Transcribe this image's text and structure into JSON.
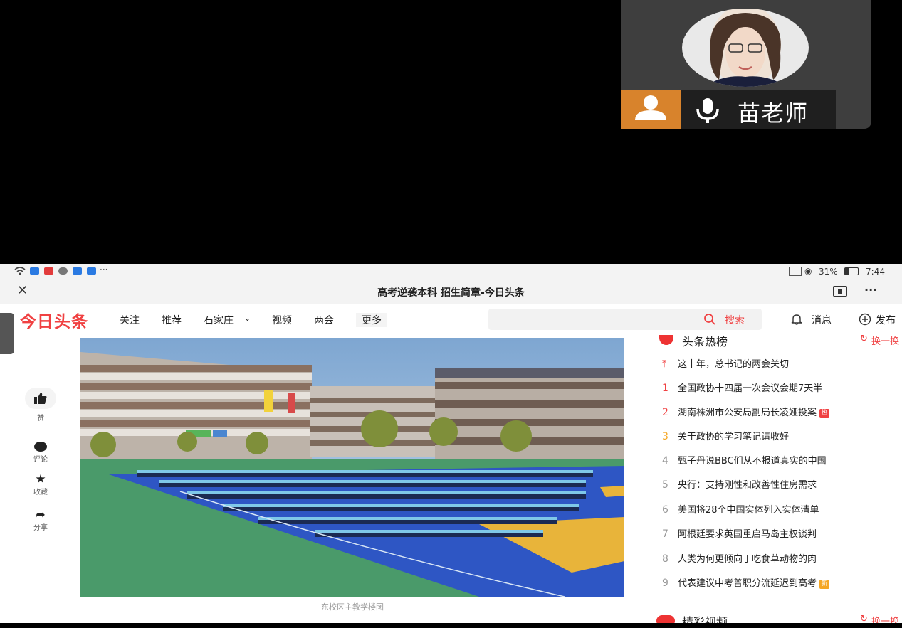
{
  "meeting": {
    "participant_name": "苗老师"
  },
  "phone": {
    "status": {
      "battery": "31%",
      "time": "7:44"
    },
    "browser": {
      "title": "高考逆袭本科 招生简章-今日头条"
    },
    "nav": {
      "logo": "今日头条",
      "items": [
        "关注",
        "推荐",
        "石家庄",
        "视频",
        "两会",
        "更多"
      ],
      "search_label": "搜索",
      "messages_label": "消息",
      "publish_label": "发布"
    },
    "article": {
      "caption": "东校区主教学楼图",
      "actions": [
        "赞",
        "评论",
        "收藏",
        "分享"
      ]
    },
    "hot_list": {
      "title": "头条热榜",
      "refresh_label": "换一换",
      "pinned": "这十年，总书记的两会关切",
      "items": [
        {
          "rank": "1",
          "text": "全国政协十四届一次会议会期7天半",
          "tag": ""
        },
        {
          "rank": "2",
          "text": "湖南株洲市公安局副局长凌娅投案",
          "tag": "热"
        },
        {
          "rank": "3",
          "text": "关于政协的学习笔记请收好",
          "tag": ""
        },
        {
          "rank": "4",
          "text": "甄子丹说BBC们从不报道真实的中国",
          "tag": ""
        },
        {
          "rank": "5",
          "text": "央行：支持刚性和改善性住房需求",
          "tag": ""
        },
        {
          "rank": "6",
          "text": "美国将28个中国实体列入实体清单",
          "tag": ""
        },
        {
          "rank": "7",
          "text": "阿根廷要求英国重启马岛主权谈判",
          "tag": ""
        },
        {
          "rank": "8",
          "text": "人类为何更倾向于吃食草动物的肉",
          "tag": ""
        },
        {
          "rank": "9",
          "text": "代表建议中考普职分流延迟到高考",
          "tag": "新"
        }
      ],
      "video_section_title": "精彩视频"
    }
  },
  "colors": {
    "brand_red": "#f04142",
    "gold": "#f5a623",
    "cam_orange": "#d8832c"
  }
}
